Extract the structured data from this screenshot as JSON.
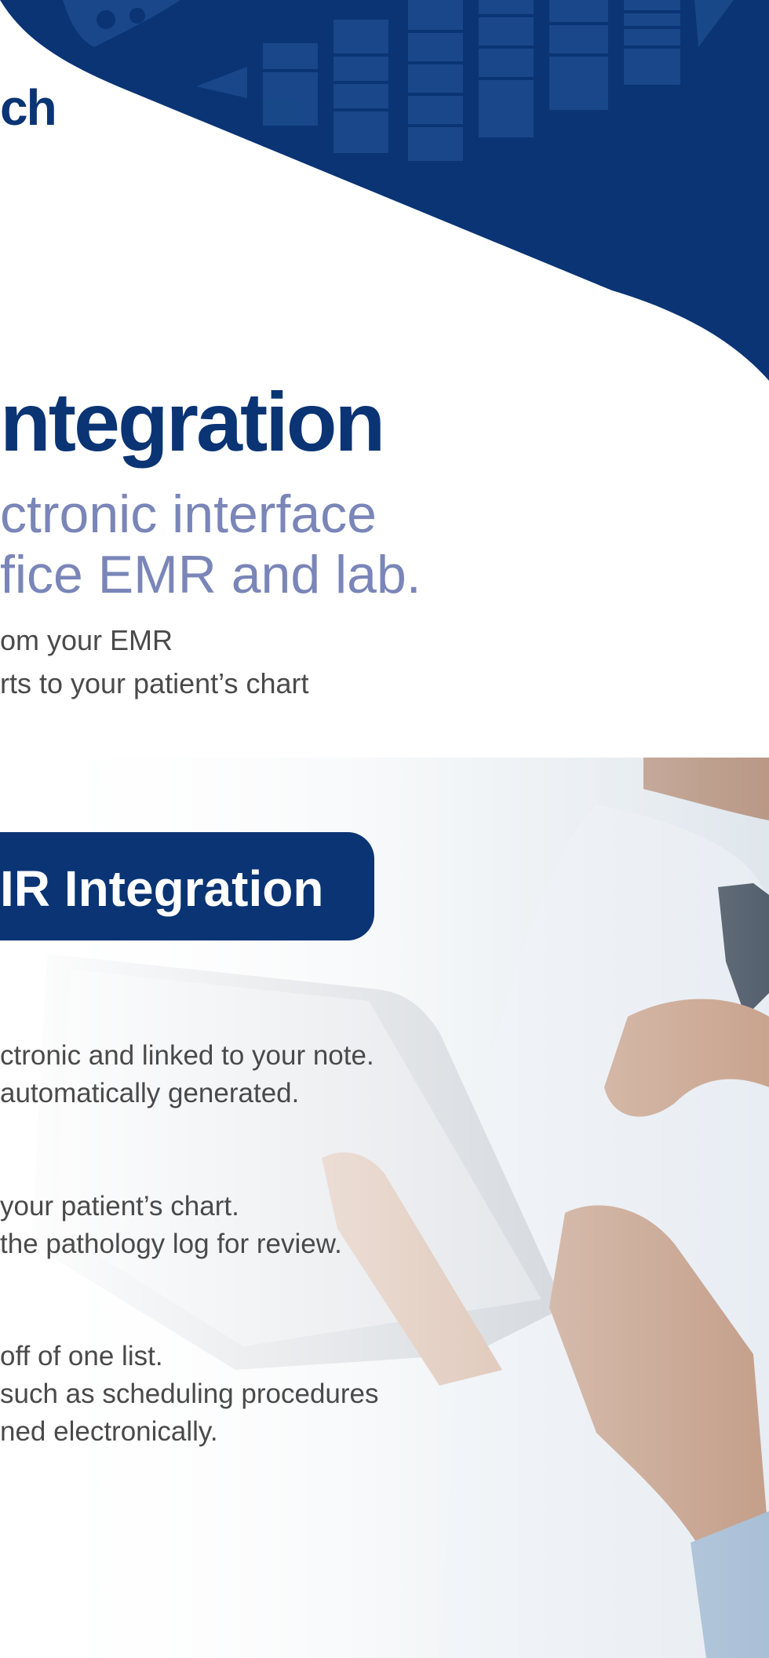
{
  "header": {
    "brand_fragment": "ch"
  },
  "hero": {
    "headline": "ntegration",
    "subhead_line1": "ctronic interface",
    "subhead_line2": "fice EMR and lab.",
    "body_line1": "om your EMR",
    "body_line2": "rts to your patient’s chart"
  },
  "section": {
    "banner_title": "IR Integration"
  },
  "features": [
    {
      "line1": "ctronic and linked to your note.",
      "line2": "automatically generated."
    },
    {
      "line1": "your patient’s chart.",
      "line2": " the pathology log for review."
    },
    {
      "line1": "off of one list.",
      "line2": "such as scheduling procedures",
      "line3": "ned electronically."
    }
  ],
  "colors": {
    "brand_navy": "#0a3474",
    "subhead_lavender": "#7a86b8",
    "body_gray": "#4a4a4a"
  }
}
